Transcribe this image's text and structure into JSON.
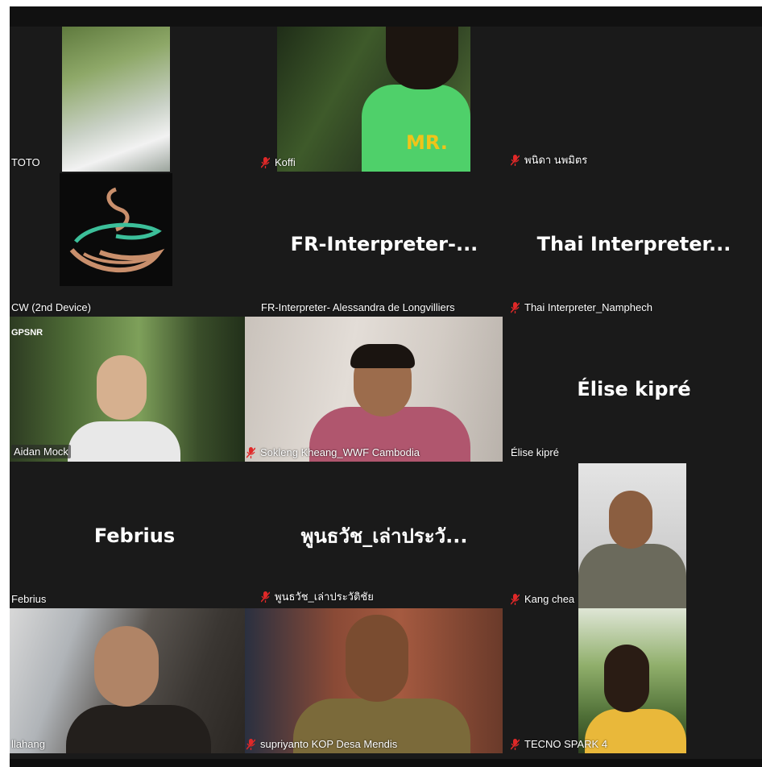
{
  "participants": [
    {
      "name": "TOTO",
      "muted": false
    },
    {
      "name": "Koffi",
      "muted": true
    },
    {
      "name": "พนิดา นพมิตร",
      "muted": true
    },
    {
      "name": "CW (2nd Device)",
      "muted": false
    },
    {
      "name": "FR-Interpreter- Alessandra de Longvilliers",
      "display": "FR-Interpreter-...",
      "muted": false
    },
    {
      "name": "Thai Interpreter_Namphech",
      "display": "Thai  Interpreter...",
      "muted": true
    },
    {
      "name": "Aidan Mock",
      "muted": false,
      "overlay": "GPSNR"
    },
    {
      "name": "Sokleng Kheang_WWF Cambodia",
      "muted": true
    },
    {
      "name": "Élise kipré",
      "display": "Élise kipré",
      "muted": false
    },
    {
      "name": "Febrius",
      "display": "Febrius",
      "muted": false
    },
    {
      "name": "พูนธวัช_เล่าประวัติชัย",
      "display": "พูนธวัช_เล่าประวั...",
      "muted": true
    },
    {
      "name": "Kang chea",
      "muted": true
    },
    {
      "name": "llahang",
      "muted": false
    },
    {
      "name": "supriyanto KOP Desa Mendis",
      "muted": true
    },
    {
      "name": "TECNO SPARK 4",
      "muted": true
    }
  ],
  "colors": {
    "background": "#1a1a1a",
    "muted_icon": "#e02828",
    "label_text": "#ffffff"
  },
  "icons": {
    "muted": "muted-mic-icon"
  }
}
